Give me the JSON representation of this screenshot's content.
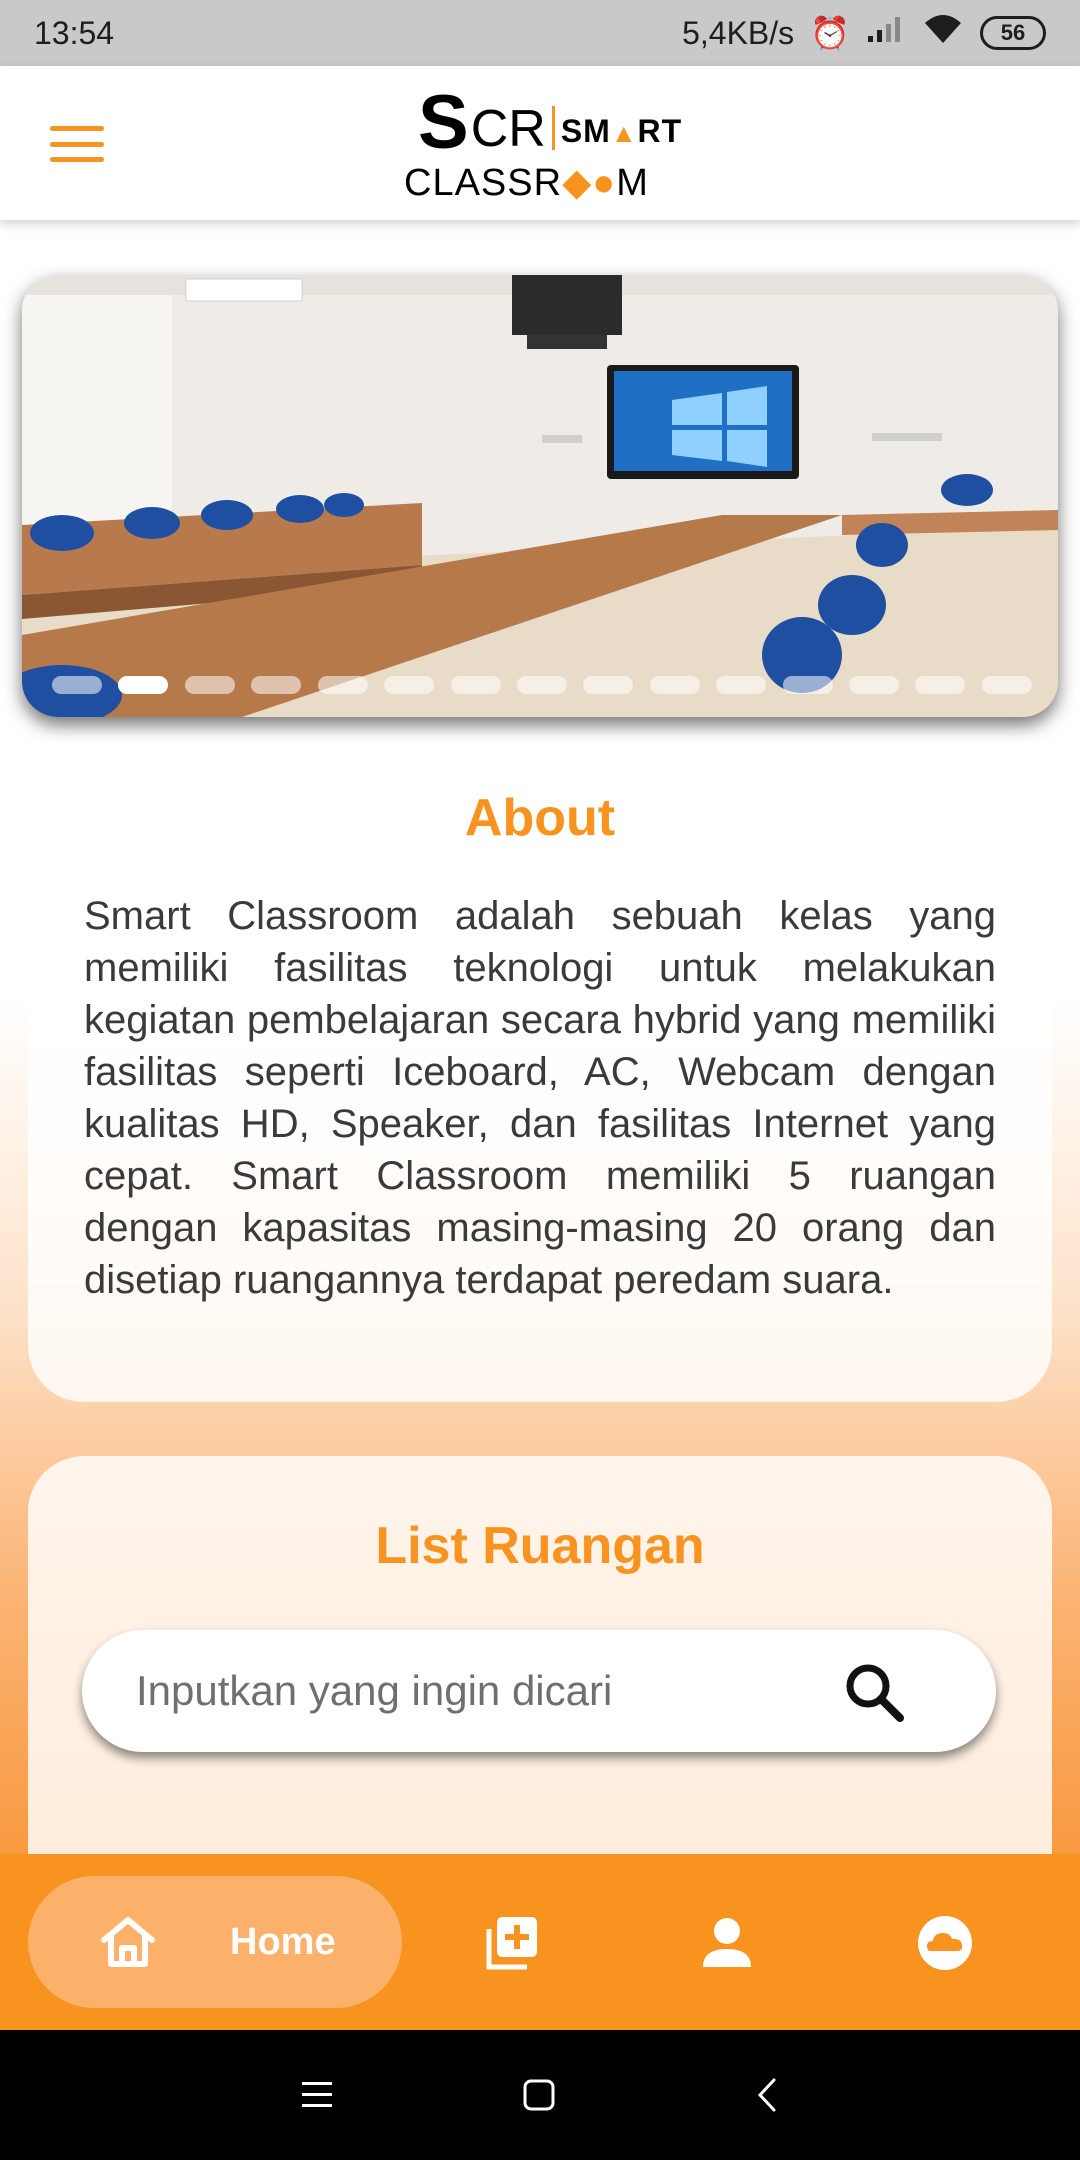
{
  "status_bar": {
    "time": "13:54",
    "network_speed": "5,4KB/s",
    "battery_level": "56",
    "icons": [
      "alarm-icon",
      "signal-icon",
      "wifi-icon",
      "battery-icon"
    ]
  },
  "header": {
    "menu_icon": "hamburger-icon",
    "logo": {
      "line1_big": "S",
      "line1_rest": "CR",
      "line1_smart_a": "SM",
      "line1_smart_tri": "▲",
      "line1_smart_b": "RT",
      "line2_a": "CLASSR",
      "line2_o1": "◆",
      "line2_o2": "●",
      "line2_b": "M"
    }
  },
  "carousel": {
    "image": "smart-classroom-photo",
    "slide_count": 15,
    "active_index": 1
  },
  "about": {
    "title": "About",
    "text": "Smart Classroom adalah sebuah kelas yang memiliki fasilitas teknologi untuk melakukan kegiatan pembelajaran secara hybrid yang memiliki fasilitas seperti Iceboard, AC, Webcam dengan kualitas HD, Speaker, dan fasilitas Internet yang cepat. Smart Classroom memiliki 5 ruangan dengan kapasitas masing-masing 20 orang dan disetiap ruangannya terdapat peredam suara."
  },
  "rooms": {
    "title": "List Ruangan",
    "search": {
      "placeholder": "Inputkan yang ingin dicari",
      "value": "",
      "icon": "search-icon"
    }
  },
  "bottom_nav": {
    "items": [
      {
        "label": "Home",
        "icon": "home-icon",
        "active": true
      },
      {
        "label": "",
        "icon": "add-box-icon",
        "active": false
      },
      {
        "label": "",
        "icon": "person-icon",
        "active": false
      },
      {
        "label": "",
        "icon": "cloud-icon",
        "active": false
      }
    ]
  },
  "system_nav": {
    "icons": [
      "recents-icon",
      "home-square-icon",
      "back-icon"
    ]
  },
  "colors": {
    "accent": "#f7931e",
    "accent_light": "#fbb16a",
    "status_bar": "#c9c9c9",
    "text": "#3a3a3a"
  }
}
